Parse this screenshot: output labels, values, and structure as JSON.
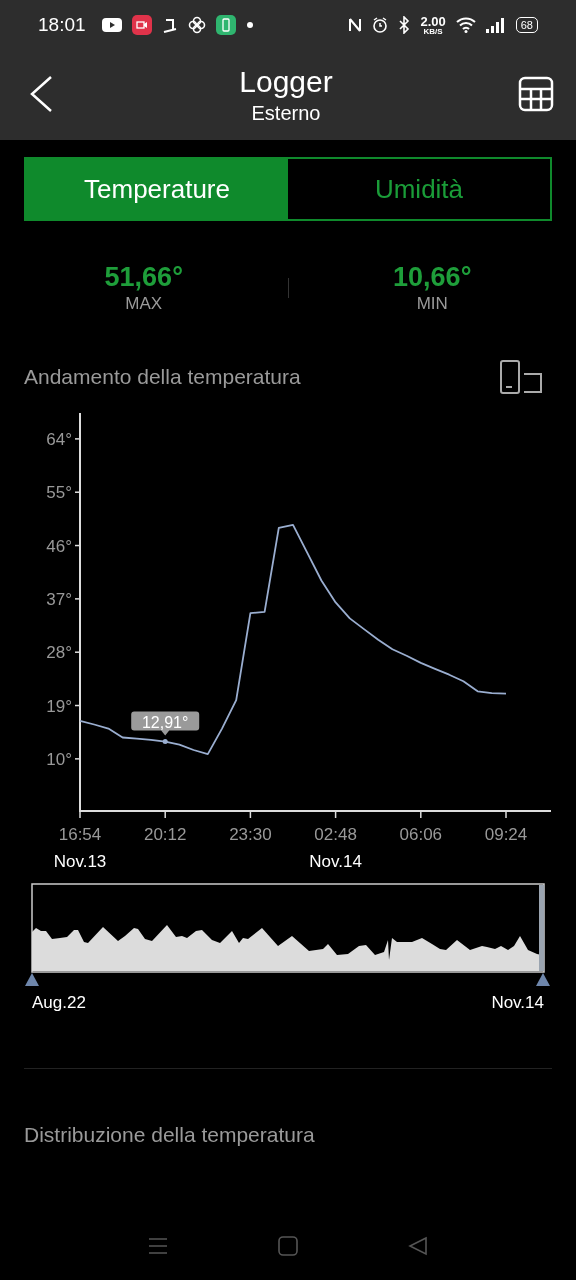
{
  "status_bar": {
    "time": "18:01",
    "net_speed": "2.00",
    "net_unit": "KB/S",
    "battery": "68"
  },
  "header": {
    "title": "Logger",
    "subtitle": "Esterno"
  },
  "tabs": [
    {
      "label": "Temperature",
      "selected": true
    },
    {
      "label": "Umidità",
      "selected": false
    }
  ],
  "stats": [
    {
      "value": "51,66°",
      "label": "MAX"
    },
    {
      "value": "10,66°",
      "label": "MIN"
    }
  ],
  "trend": {
    "title": "Andamento della temperatura",
    "date_labels": [
      "Nov.13",
      "Nov.14"
    ],
    "chart_data": {
      "type": "line",
      "ylim": [
        1.2,
        68.2
      ],
      "categories": [
        "16:54",
        null,
        null,
        null,
        null,
        null,
        "20:12",
        null,
        null,
        null,
        null,
        null,
        "23:30",
        null,
        null,
        null,
        null,
        null,
        "02:48",
        null,
        null,
        null,
        null,
        null,
        "06:06",
        null,
        null,
        null,
        null,
        null,
        "09:24"
      ],
      "yticks": [
        {
          "value": 10,
          "label": "10°"
        },
        {
          "value": 19,
          "label": "19°"
        },
        {
          "value": 28,
          "label": "28°"
        },
        {
          "value": 37,
          "label": "37°"
        },
        {
          "value": 46,
          "label": "46°"
        },
        {
          "value": 55,
          "label": "55°"
        },
        {
          "value": 64,
          "label": "64°"
        }
      ],
      "series": [
        {
          "color": "#9aaed0",
          "values": [
            16.4,
            15.8,
            15.1,
            13.6,
            13.4,
            13.2,
            12.9,
            12.4,
            11.5,
            10.8,
            15.1,
            19.9,
            34.6,
            34.8,
            49.0,
            49.5,
            44.8,
            40.1,
            36.4,
            33.7,
            31.9,
            30.1,
            28.5,
            27.4,
            26.2,
            25.2,
            24.2,
            23.1,
            21.4,
            21.1,
            21.0
          ]
        }
      ],
      "annotations": [
        {
          "x": "20:12",
          "y": 12.91,
          "text": "12,91°"
        }
      ]
    }
  },
  "overview": {
    "start_label": "Aug.22",
    "end_label": "Nov.14"
  },
  "distribution": {
    "title": "Distribuzione della temperatura"
  }
}
